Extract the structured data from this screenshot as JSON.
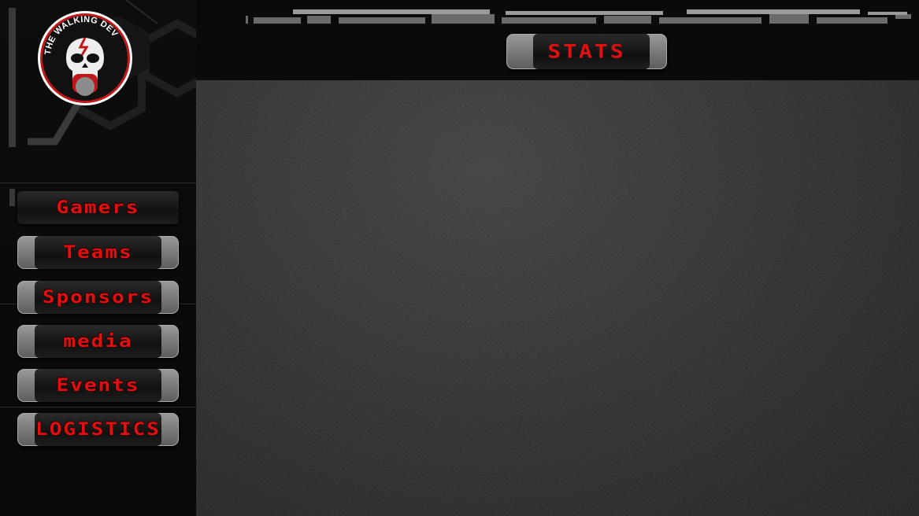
{
  "logo": {
    "text": "THE WALKING DEV",
    "icon": "skull-icon"
  },
  "header": {
    "stats_label": "STATS"
  },
  "nav": {
    "items": [
      {
        "label": "Gamers"
      },
      {
        "label": "Teams"
      },
      {
        "label": "Sponsors"
      },
      {
        "label": "media"
      },
      {
        "label": "Events"
      },
      {
        "label": "LOGISTICS"
      }
    ]
  },
  "colors": {
    "accent": "#e01010",
    "button": "#7a7a7a",
    "background": "#2e2e2e"
  }
}
